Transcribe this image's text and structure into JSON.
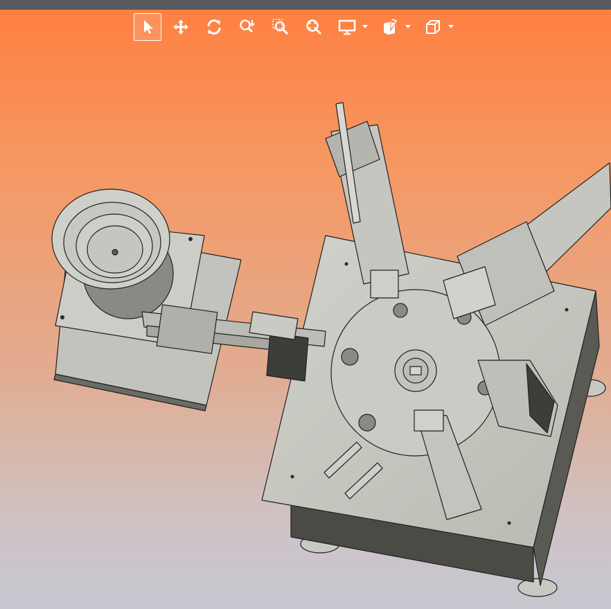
{
  "window": {
    "title": ""
  },
  "toolbar": {
    "buttons": [
      {
        "name": "select",
        "icon": "arrow-pointer-icon",
        "active": true
      },
      {
        "name": "pan",
        "icon": "move-arrows-icon",
        "active": false
      },
      {
        "name": "rotate",
        "icon": "rotate-icon",
        "active": false
      },
      {
        "name": "zoom",
        "icon": "zoom-icon",
        "active": false
      },
      {
        "name": "zoom-window",
        "icon": "zoom-window-icon",
        "active": false
      },
      {
        "name": "zoom-fit",
        "icon": "zoom-fit-icon",
        "active": false
      },
      {
        "name": "display-mode",
        "icon": "monitor-icon",
        "dropdown": true
      },
      {
        "name": "section-view",
        "icon": "section-box-icon",
        "dropdown": true
      },
      {
        "name": "standard-views",
        "icon": "cube-icon",
        "dropdown": true
      }
    ]
  },
  "colors": {
    "background_top": "#ff7f3f",
    "background_bottom": "#c7c7cf",
    "model_fill": "#c9c9c3",
    "model_edge": "#1f1f1f",
    "toolbar_icon": "#ffffff",
    "top_bar": "#58595c"
  },
  "viewport": {
    "description_icon": "cad-3d-model-icon"
  }
}
